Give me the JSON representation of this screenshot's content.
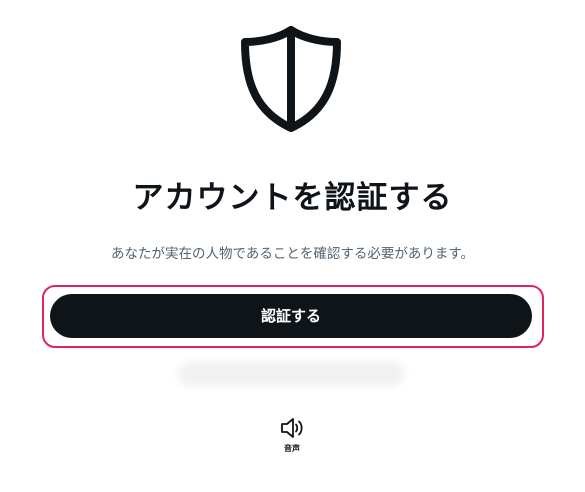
{
  "header": {
    "icon": "shield-icon"
  },
  "main": {
    "title": "アカウントを認証する",
    "description": "あなたが実在の人物であることを確認する必要があります。",
    "verify_button_label": "認証する"
  },
  "audio": {
    "icon": "speaker-icon",
    "label": "音声"
  },
  "colors": {
    "primary_button": "#0f1419",
    "focus_ring": "#e0245e",
    "secondary_text": "#536471"
  }
}
